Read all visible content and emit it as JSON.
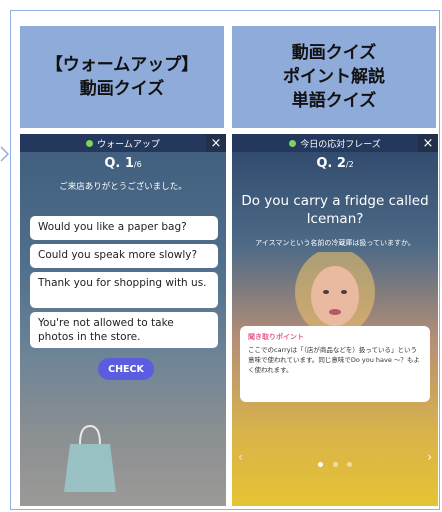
{
  "header_left": {
    "line1": "【ウォームアップ】",
    "line2": "動画クイズ"
  },
  "header_right": {
    "line1": "動画クイズ",
    "line2": "ポイント解説",
    "line3": "単語クイズ"
  },
  "screen1": {
    "topbar_label": "ウォームアップ",
    "close": "×",
    "question_number": "Q. 1",
    "question_total": "/6",
    "prompt": "ご来店ありがとうございました。",
    "options": [
      "Would you like a paper bag?",
      "Could you speak more slowly?",
      "Thank you for shopping with us.",
      "You're not allowed to take photos in the store."
    ],
    "check_label": "CHECK"
  },
  "screen2": {
    "topbar_label": "今日の応対フレーズ",
    "close": "×",
    "question_number": "Q. 2",
    "question_total": "/2",
    "question": "Do you carry a fridge called Iceman?",
    "translation": "アイスマンという名前の冷蔵庫は扱っていますか。",
    "panel_title": "聞き取りポイント",
    "panel_body": "ここでのcarryは「（店が商品などを）扱っている」という意味で使われています。同じ意味でDo you have ～？もよく使われます。",
    "nav_prev": "‹",
    "nav_next": "›"
  },
  "colors": {
    "header_bg": "#8fabd9",
    "frame_border": "#8fb0dd",
    "check_button": "#5b5ce0",
    "panel_title": "#e65a8f",
    "topbar": "#23385c"
  }
}
